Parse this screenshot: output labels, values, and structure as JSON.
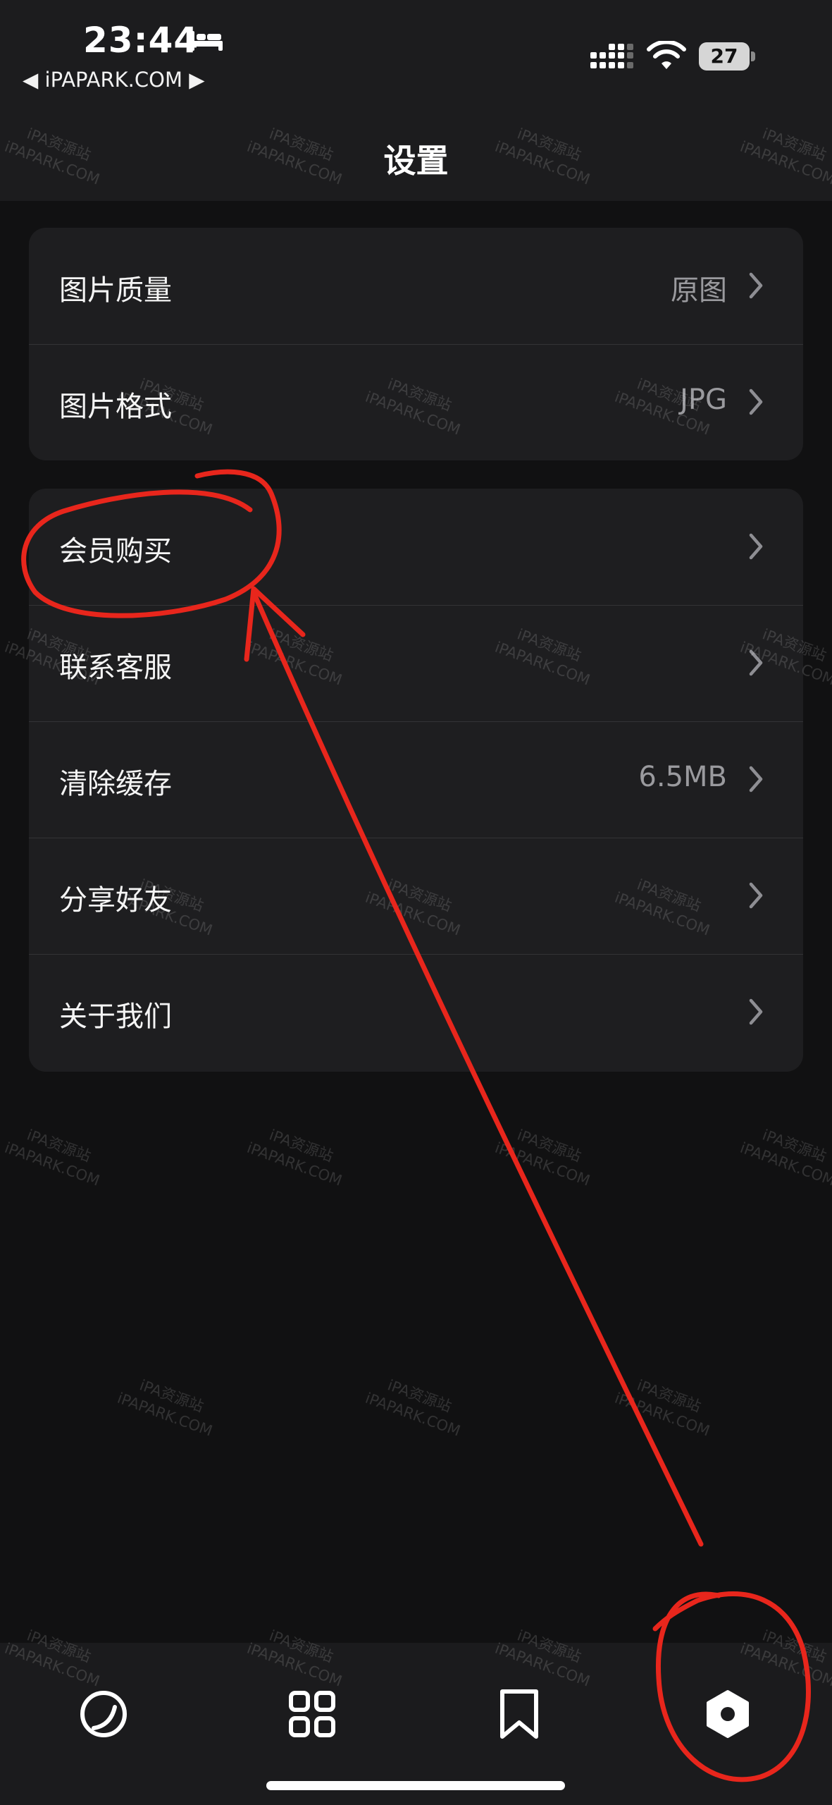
{
  "status_bar": {
    "time": "23:44",
    "back_link": "◀ iPAPARK.COM ▶",
    "battery": "27",
    "icons": [
      "bed-icon",
      "signal-icon",
      "wifi-icon",
      "battery-icon"
    ]
  },
  "nav": {
    "title": "设置"
  },
  "group1": [
    {
      "label": "图片质量",
      "value": "原图"
    },
    {
      "label": "图片格式",
      "value": "JPG"
    }
  ],
  "group2": [
    {
      "label": "会员购买",
      "value": ""
    },
    {
      "label": "联系客服",
      "value": ""
    },
    {
      "label": "清除缓存",
      "value": "6.5MB"
    },
    {
      "label": "分享好友",
      "value": ""
    },
    {
      "label": "关于我们",
      "value": ""
    }
  ],
  "tab_bar": {
    "icons": [
      "discover-icon",
      "grid-icon",
      "bookmark-icon",
      "settings-icon"
    ],
    "selected": 3
  },
  "watermark": {
    "line1": "iPA资源站",
    "line2": "iPAPARK.COM"
  },
  "colors": {
    "background": "#111112",
    "card": "#1e1e20",
    "secondary_text": "#9a9a9e",
    "annotation": "#e8261c"
  }
}
